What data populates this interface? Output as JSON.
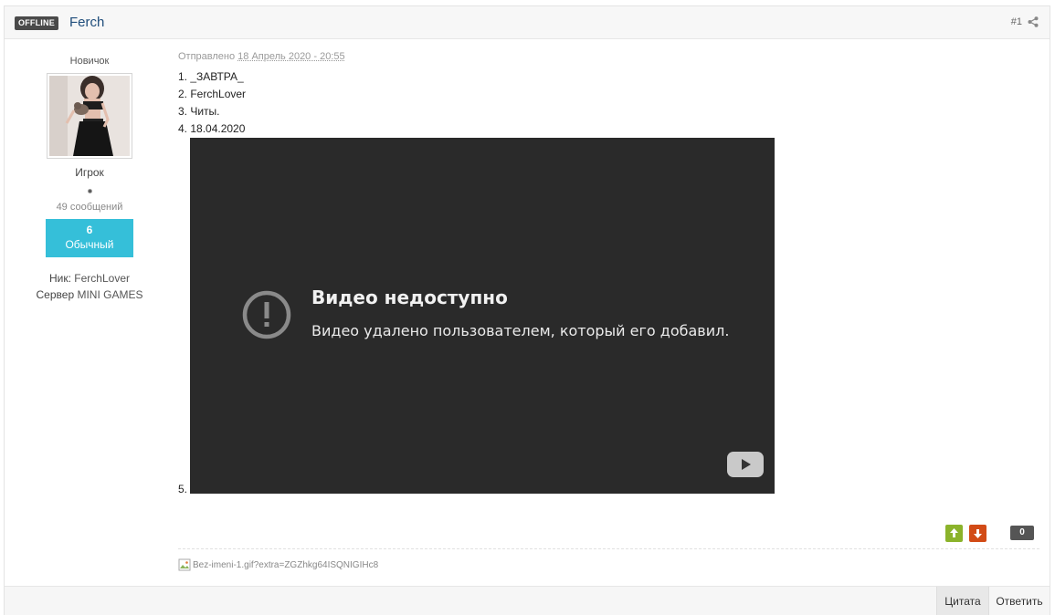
{
  "header": {
    "status_badge": "OFFLINE",
    "author_name": "Ferch",
    "post_number": "#1",
    "share_icon": "share-icon"
  },
  "author": {
    "member_title": "Новичок",
    "group": "Игрок",
    "post_count": "49 сообщений",
    "reputation": {
      "value": "6",
      "label": "Обычный",
      "color": "#35bfd9"
    },
    "fields": [
      {
        "label": "Ник:",
        "value": "FerchLover"
      },
      {
        "label": "Сервер",
        "value": "MINI GAMES"
      }
    ]
  },
  "post": {
    "posted_label": "Отправлено",
    "posted_date": "18 Апрель 2020 - 20:55",
    "lines": [
      "1. _ЗАВТРА_",
      "2. FerchLover",
      "3. Читы.",
      "4. 18.04.2020"
    ],
    "item5_number": "5.",
    "video": {
      "title": "Видео недоступно",
      "message": "Видео удалено пользователем, который его добавил."
    }
  },
  "votes": {
    "score": "0",
    "up_color": "#8bb32b",
    "down_color": "#d24b16"
  },
  "signature": {
    "image_alt": "Bez-imeni-1.gif?extra=ZGZhkg64ISQNIGIHc8"
  },
  "footer": {
    "quote_label": "Цитата",
    "reply_label": "Ответить"
  }
}
